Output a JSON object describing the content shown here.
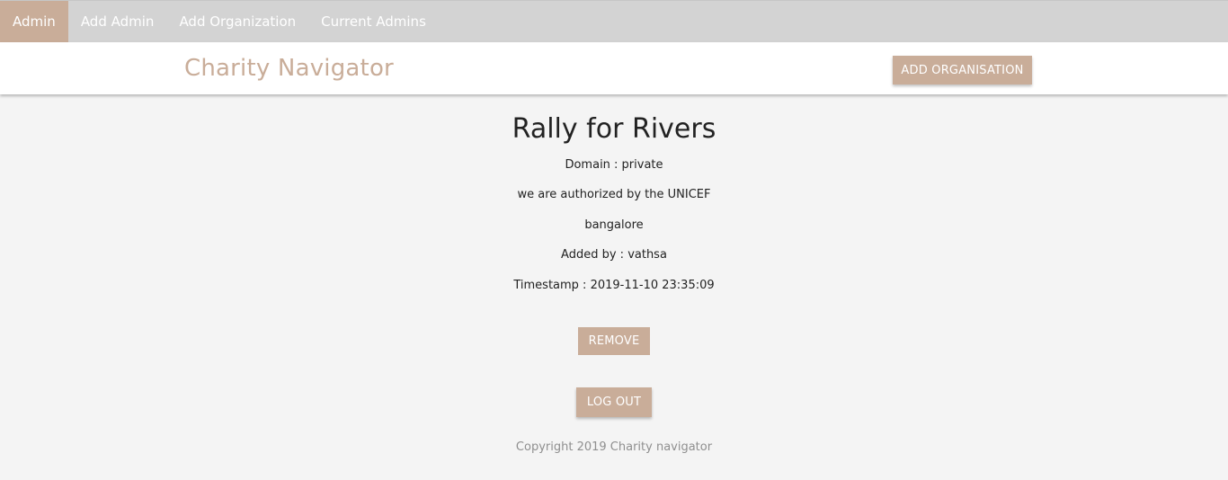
{
  "nav": {
    "tabs": [
      {
        "label": "Admin",
        "active": true
      },
      {
        "label": "Add Admin",
        "active": false
      },
      {
        "label": "Add Organization",
        "active": false
      },
      {
        "label": "Current Admins",
        "active": false
      }
    ]
  },
  "header": {
    "brand": "Charity Navigator",
    "add_org_label": "ADD ORGANISATION"
  },
  "organization": {
    "name": "Rally for Rivers",
    "domain": "Domain : private",
    "description": "we are authorized by the UNICEF",
    "location": "bangalore",
    "added_by": "Added by : vathsa",
    "timestamp": "Timestamp : 2019-11-10 23:35:09",
    "remove_label": "REMOVE"
  },
  "actions": {
    "logout_label": "LOG OUT"
  },
  "footer": {
    "copyright": "Copyright 2019 Charity navigator"
  },
  "colors": {
    "accent": "#c9ad99",
    "nav_bg": "#d3d3d3",
    "page_bg": "#f4f4f4"
  }
}
